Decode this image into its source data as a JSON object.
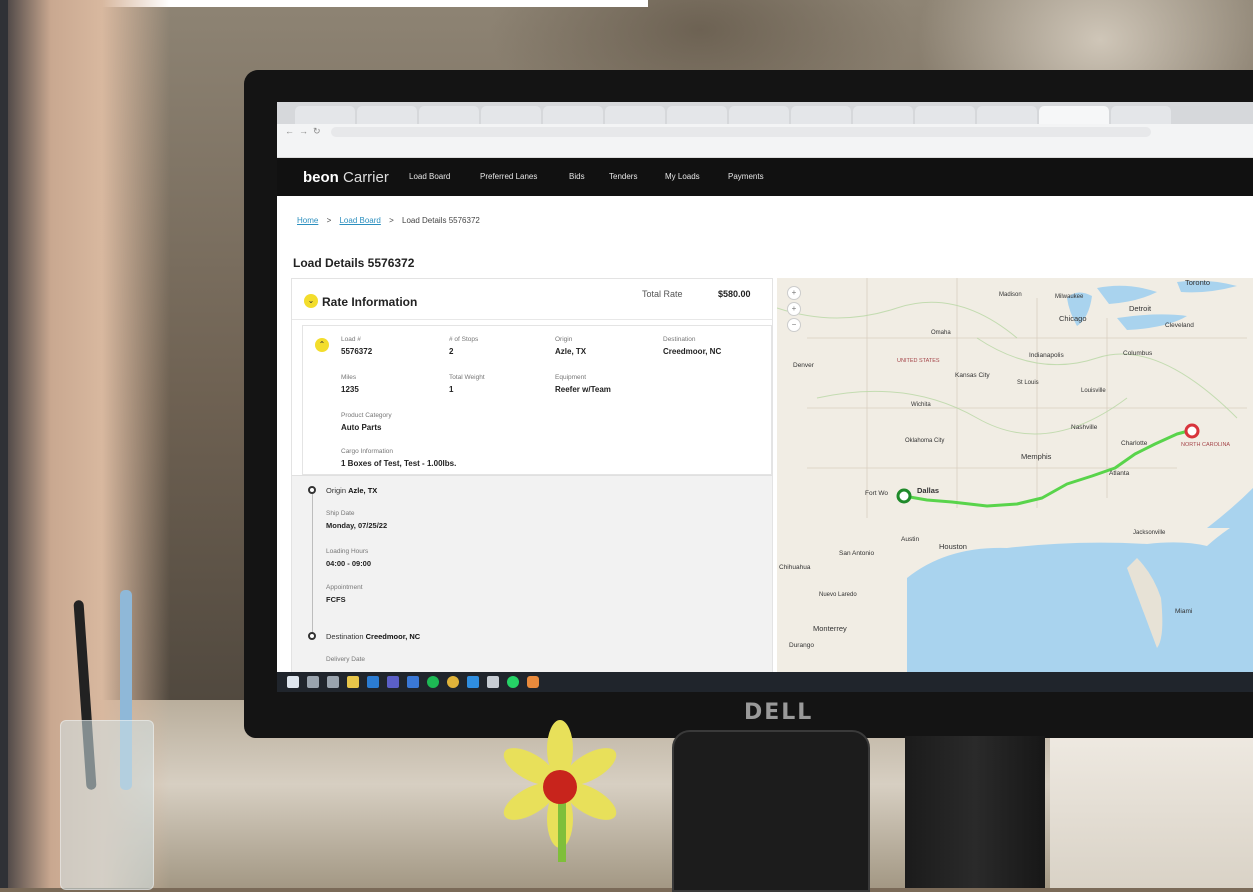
{
  "browser": {
    "tabs": [
      "",
      "",
      "",
      "",
      "",
      "",
      "",
      "",
      "",
      "",
      "",
      "",
      "",
      ""
    ],
    "address": "",
    "bookmarks": [
      "",
      "",
      "",
      "",
      "",
      "",
      "",
      "",
      "",
      "",
      "",
      "",
      ""
    ]
  },
  "app": {
    "logo_brand": "beon",
    "logo_product": "Carrier",
    "nav": [
      "Load Board",
      "Preferred Lanes",
      "Bids",
      "Tenders",
      "My Loads",
      "Payments"
    ]
  },
  "breadcrumb": {
    "home": "Home",
    "sep1": ">",
    "load_board": "Load Board",
    "sep2": ">",
    "current": "Load Details 5576372"
  },
  "page_title": "Load Details 5576372",
  "rate_card": {
    "title": "Rate Information",
    "total_rate_label": "Total Rate",
    "total_rate_value": "$580.00",
    "fields": {
      "load_label": "Load #",
      "load_value": "5576372",
      "stops_label": "# of Stops",
      "stops_value": "2",
      "origin_label": "Origin",
      "origin_value": "Azle, TX",
      "destination_label": "Destination",
      "destination_value": "Creedmoor, NC",
      "miles_label": "Miles",
      "miles_value": "1235",
      "weight_label": "Total Weight",
      "weight_value": "1",
      "equipment_label": "Equipment",
      "equipment_value": "Reefer w/Team",
      "category_label": "Product Category",
      "category_value": "Auto Parts",
      "cargo_label": "Cargo Information",
      "cargo_value": "1 Boxes of Test, Test - 1.00lbs."
    }
  },
  "route": {
    "origin_prefix": "Origin",
    "origin_city": "Azle, TX",
    "ship_date_label": "Ship Date",
    "ship_date_value": "Monday, 07/25/22",
    "loading_hours_label": "Loading Hours",
    "loading_hours_value": "04:00 - 09:00",
    "appointment_label": "Appointment",
    "appointment_value": "FCFS",
    "destination_prefix": "Destination",
    "destination_city": "Creedmoor, NC",
    "delivery_date_label": "Delivery Date"
  },
  "map": {
    "labels": {
      "toronto": "Toronto",
      "madison": "Madison",
      "milwaukee": "Milwaukee",
      "detroit": "Detroit",
      "chicago": "Chicago",
      "cleveland": "Cleveland",
      "omaha": "Omaha",
      "indianapolis": "Indianapolis",
      "columbus": "Columbus",
      "denver": "Denver",
      "united_states": "UNITED STATES",
      "kansas_city": "Kansas City",
      "st_louis": "St Louis",
      "louisville": "Louisville",
      "wichita": "Wichita",
      "nashville": "Nashville",
      "oklahoma_city": "Oklahoma City",
      "charlotte": "Charlotte",
      "memphis": "Memphis",
      "atlanta": "Atlanta",
      "fort_worth": "Fort Wo",
      "dallas": "Dallas",
      "austin": "Austin",
      "houston": "Houston",
      "jacksonville": "Jacksonville",
      "san_antonio": "San Antonio",
      "chihuahua": "Chihuahua",
      "nuevo_laredo": "Nuevo Laredo",
      "monterrey": "Monterrey",
      "durango": "Durango",
      "miami": "Miami",
      "north_carolina": "NORTH CAROLINA"
    },
    "route_color": "#59d44b",
    "origin_marker_color": "#1f8a2a",
    "destination_marker_color": "#d8343c",
    "water_color": "#a9d3ee"
  },
  "monitor_brand": "DELL",
  "colors": {
    "accent_yellow": "#f3dd2c",
    "appbar": "#111111",
    "link": "#2b8fbf"
  }
}
